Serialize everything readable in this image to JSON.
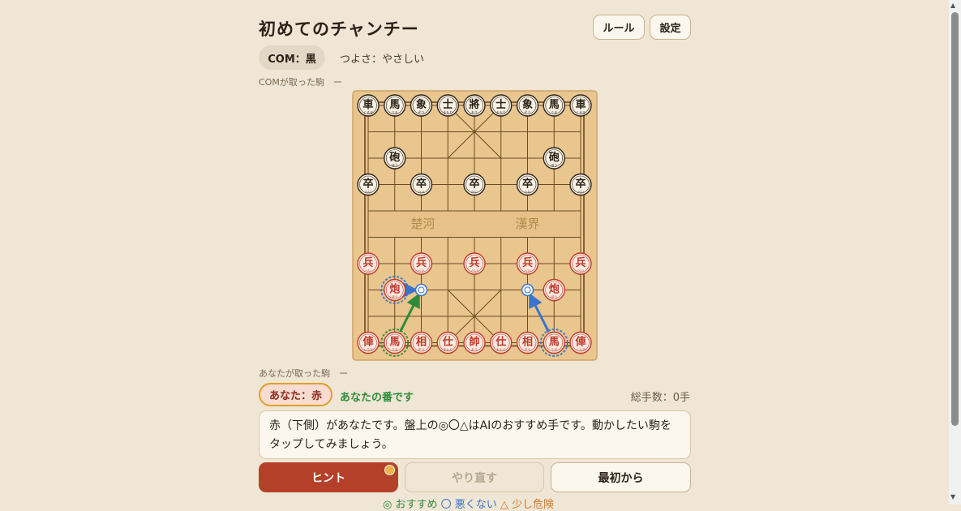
{
  "header": {
    "title": "初めてのチャンチー",
    "rules_label": "ルール",
    "settings_label": "設定"
  },
  "status": {
    "com_label": "COM：黒",
    "strength": "つよさ：やさしい",
    "com_captured": "COMが取った駒　ー",
    "you_captured": "あなたが取った駒　ー",
    "you_label": "あなた：赤",
    "turn": "あなたの番です",
    "moves": "総手数：0手"
  },
  "message": "赤（下側）があなたです。盤上の◎〇△はAIのおすすめ手です。動かしたい駒をタップしてみましょう。",
  "buttons": {
    "hint": "ヒント",
    "undo": "やり直す",
    "restart": "最初から"
  },
  "legend": {
    "recommended": "◎ おすすめ",
    "bad": "〇 悪くない",
    "risky": "△ 少し危険"
  },
  "board": {
    "river_left": "楚河",
    "river_right": "漢界",
    "colors": {
      "red": "#c0392b",
      "black": "#2b2118",
      "wood": "#e9c68e",
      "recommend": "#2e8b3a",
      "ok": "#3b74c8"
    },
    "pieces": [
      {
        "side": "black",
        "char": "車",
        "sub": "くるま",
        "col": 0,
        "row": 0
      },
      {
        "side": "black",
        "char": "馬",
        "sub": "うま",
        "col": 1,
        "row": 0
      },
      {
        "side": "black",
        "char": "象",
        "sub": "ぞう",
        "col": 2,
        "row": 0
      },
      {
        "side": "black",
        "char": "士",
        "sub": "まもり",
        "col": 3,
        "row": 0
      },
      {
        "side": "black",
        "char": "將",
        "sub": "おう",
        "col": 4,
        "row": 0
      },
      {
        "side": "black",
        "char": "士",
        "sub": "まもり",
        "col": 5,
        "row": 0
      },
      {
        "side": "black",
        "char": "象",
        "sub": "ぞう",
        "col": 6,
        "row": 0
      },
      {
        "side": "black",
        "char": "馬",
        "sub": "うま",
        "col": 7,
        "row": 0
      },
      {
        "side": "black",
        "char": "車",
        "sub": "くるま",
        "col": 8,
        "row": 0
      },
      {
        "side": "black",
        "char": "砲",
        "sub": "ほう",
        "col": 1,
        "row": 2
      },
      {
        "side": "black",
        "char": "砲",
        "sub": "ほう",
        "col": 7,
        "row": 2
      },
      {
        "side": "black",
        "char": "卒",
        "sub": "へい",
        "col": 0,
        "row": 3
      },
      {
        "side": "black",
        "char": "卒",
        "sub": "へい",
        "col": 2,
        "row": 3
      },
      {
        "side": "black",
        "char": "卒",
        "sub": "へい",
        "col": 4,
        "row": 3
      },
      {
        "side": "black",
        "char": "卒",
        "sub": "へい",
        "col": 6,
        "row": 3
      },
      {
        "side": "black",
        "char": "卒",
        "sub": "へい",
        "col": 8,
        "row": 3
      },
      {
        "side": "red",
        "char": "兵",
        "sub": "へい",
        "col": 0,
        "row": 6
      },
      {
        "side": "red",
        "char": "兵",
        "sub": "へい",
        "col": 2,
        "row": 6
      },
      {
        "side": "red",
        "char": "兵",
        "sub": "へい",
        "col": 4,
        "row": 6
      },
      {
        "side": "red",
        "char": "兵",
        "sub": "へい",
        "col": 6,
        "row": 6
      },
      {
        "side": "red",
        "char": "兵",
        "sub": "へい",
        "col": 8,
        "row": 6
      },
      {
        "side": "red",
        "char": "炮",
        "sub": "ほう",
        "col": 1,
        "row": 7,
        "ring": "ok"
      },
      {
        "side": "red",
        "char": "炮",
        "sub": "ほう",
        "col": 7,
        "row": 7
      },
      {
        "side": "red",
        "char": "俥",
        "sub": "くるま",
        "col": 0,
        "row": 9
      },
      {
        "side": "red",
        "char": "馬",
        "sub": "うま",
        "col": 1,
        "row": 9,
        "ring": "recommend"
      },
      {
        "side": "red",
        "char": "相",
        "sub": "ぞう",
        "col": 2,
        "row": 9
      },
      {
        "side": "red",
        "char": "仕",
        "sub": "まもり",
        "col": 3,
        "row": 9
      },
      {
        "side": "red",
        "char": "帥",
        "sub": "おう",
        "col": 4,
        "row": 9
      },
      {
        "side": "red",
        "char": "仕",
        "sub": "まもり",
        "col": 5,
        "row": 9
      },
      {
        "side": "red",
        "char": "相",
        "sub": "ぞう",
        "col": 6,
        "row": 9
      },
      {
        "side": "red",
        "char": "馬",
        "sub": "うま",
        "col": 7,
        "row": 9,
        "ring": "ok"
      },
      {
        "side": "red",
        "char": "俥",
        "sub": "くるま",
        "col": 8,
        "row": 9
      }
    ],
    "hints": [
      {
        "kind": "recommend",
        "from": [
          1,
          9
        ],
        "to": [
          2,
          7
        ]
      },
      {
        "kind": "ok",
        "from": [
          7,
          9
        ],
        "to": [
          6,
          7
        ]
      },
      {
        "kind": "ok",
        "from": [
          1,
          7
        ],
        "to": [
          2,
          7
        ]
      }
    ]
  }
}
